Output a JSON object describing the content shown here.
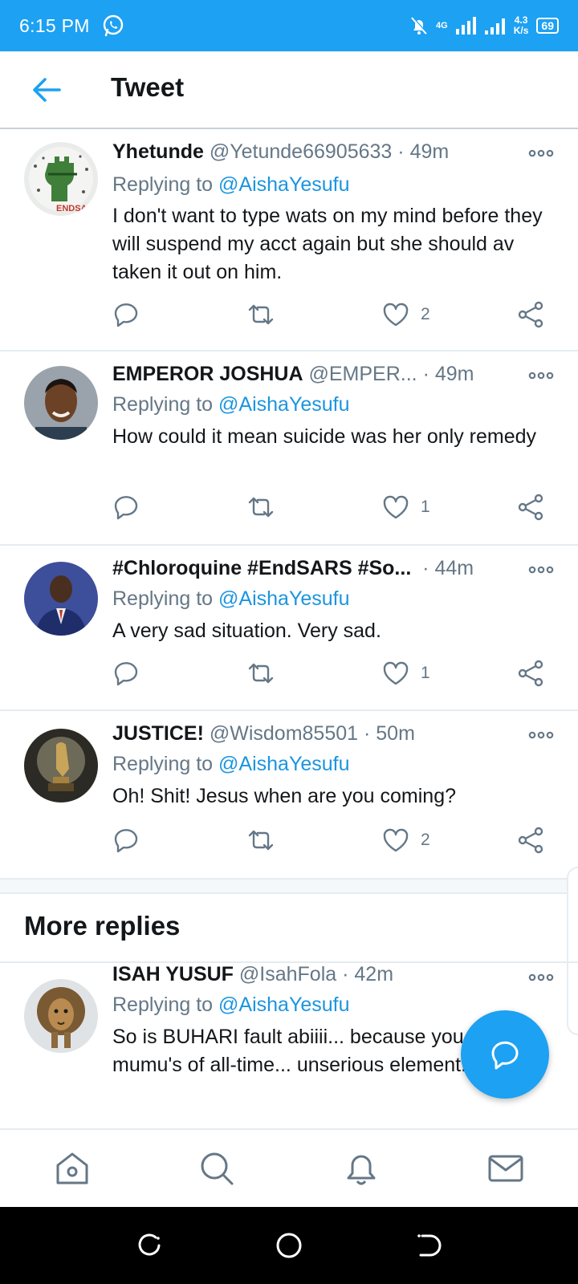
{
  "status_bar": {
    "time": "6:15 PM",
    "network": "4G",
    "speed_value": "4.3",
    "speed_unit": "K/s",
    "battery": "69",
    "color": "#1da1f2"
  },
  "header": {
    "title": "Tweet"
  },
  "tweets": [
    {
      "name": "Yhetunde",
      "handle": "@Yetunde66905633",
      "time": "49m",
      "replying_prefix": "Replying to ",
      "replying_to": "@AishaYesufu",
      "text": "I don't want to type wats on my mind before they will suspend my acct again but she should av taken it out on him.",
      "likes": "2",
      "avatar_text": "ENDSARS"
    },
    {
      "name": "EMPEROR JOSHUA",
      "handle": "@EMPER...",
      "time": "49m",
      "replying_prefix": "Replying to ",
      "replying_to": "@AishaYesufu",
      "text": "How could it mean suicide was her only remedy",
      "likes": "1"
    },
    {
      "name": "#Chloroquine #EndSARS #So...",
      "handle": "",
      "time": "44m",
      "replying_prefix": "Replying to ",
      "replying_to": "@AishaYesufu",
      "text": "A very sad situation. Very sad.",
      "likes": "1"
    },
    {
      "name": "JUSTICE!",
      "handle": "@Wisdom85501",
      "time": "50m",
      "replying_prefix": "Replying to ",
      "replying_to": "@AishaYesufu",
      "text": "Oh! Shit! Jesus when are you coming?",
      "likes": "2"
    }
  ],
  "more_replies": {
    "heading": "More replies",
    "tweet": {
      "name": "ISAH YUSUF",
      "handle": "@IsahFola",
      "time": "42m",
      "replying_prefix": "Replying to ",
      "replying_to": "@AishaYesufu",
      "text": "So is BUHARI fault abiiii... because you are the mumu's of all-time... unserious element...."
    }
  },
  "icons": {
    "back": "back-arrow-icon",
    "more": "more-options-icon",
    "reply": "reply-icon",
    "retweet": "retweet-icon",
    "like": "heart-icon",
    "share": "share-icon",
    "compose": "compose-reply-icon",
    "home": "home-icon",
    "search": "search-icon",
    "notifications": "bell-icon",
    "messages": "mail-icon"
  },
  "colors": {
    "accent": "#1da1f2",
    "mention": "#1b95e0",
    "secondary_text": "#657786"
  }
}
